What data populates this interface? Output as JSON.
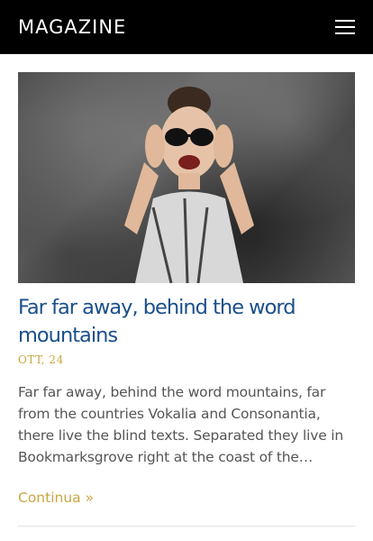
{
  "header": {
    "brand": "MAGAZINE",
    "menu_icon": "hamburger-menu-icon"
  },
  "post": {
    "image_alt": "woman laughing",
    "title": "Far far away, behind the word mountains",
    "date": "OTT, 24",
    "excerpt": "Far far away, behind the word mountains, far from the countries Vokalia and Consonantia, there live the blind texts. Separated they live in Bookmarksgrove right at the coast of the…",
    "more_label": "Continua »"
  },
  "colors": {
    "header_bg": "#000000",
    "title": "#1a4f8a",
    "accent": "#c9a642"
  }
}
